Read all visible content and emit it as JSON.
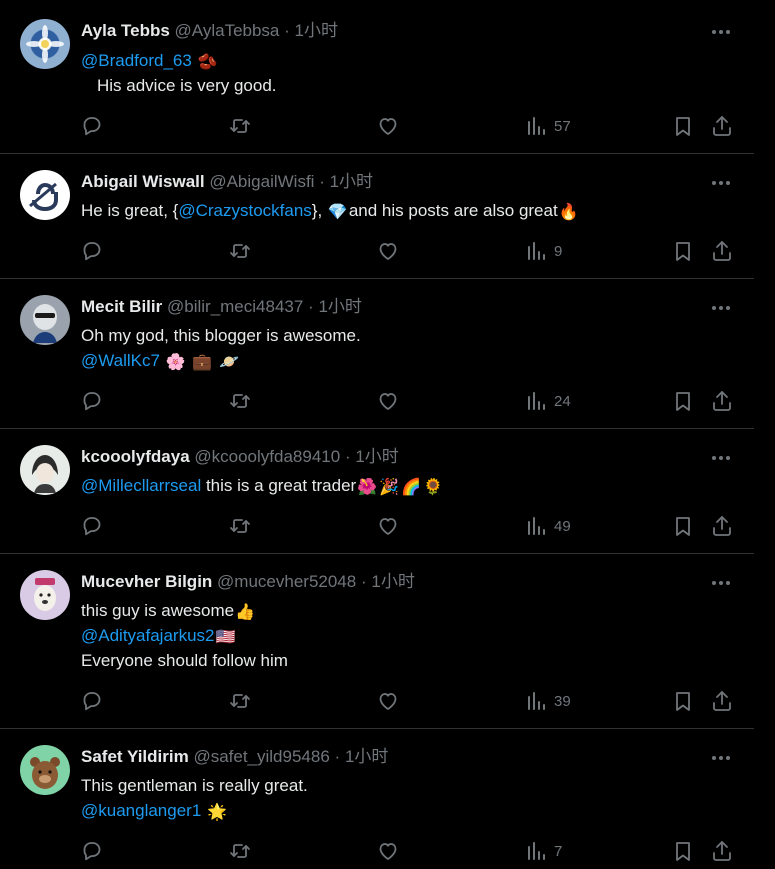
{
  "colors": {
    "background": "#000000",
    "text": "#e7e9ea",
    "muted": "#71767b",
    "link": "#1d9bf0",
    "divider": "#2f3336"
  },
  "icons": {
    "reply": "reply-icon",
    "retweet": "retweet-icon",
    "like": "heart-icon",
    "views": "views-icon",
    "bookmark": "bookmark-icon",
    "share": "share-icon",
    "more": "more-icon"
  },
  "tweets": [
    {
      "name": "Ayla Tebbs",
      "handle": "@AylaTebbsa",
      "sep": "·",
      "time": "1小时",
      "line1_mention": "@Bradford_63",
      "line1_emoji": "🫘",
      "line2_text": "His advice is very good.",
      "views": "57"
    },
    {
      "name": "Abigail Wiswall",
      "handle": "@AbigailWisfi",
      "sep": "·",
      "time": "1小时",
      "text_a": "He is great, {",
      "mention": "@Crazystockfans",
      "text_b": "}, ",
      "emoji_a": "💎",
      "text_c": "and his posts are also great",
      "emoji_b": "🔥",
      "views": "9"
    },
    {
      "name": "Mecit Bilir",
      "handle": "@bilir_meci48437",
      "sep": "·",
      "time": "1小时",
      "line1_text": "Oh my god, this blogger is awesome.",
      "line2_mention": "@WallKc7",
      "emojis": [
        "🌸",
        "💼",
        "🪐"
      ],
      "views": "24"
    },
    {
      "name": "kcooolyfdaya",
      "handle": "@kcooolyfda89410",
      "sep": "·",
      "time": "1小时",
      "mention": "@Millecllarrseal",
      "text": " this is a great trader",
      "emojis": [
        "🌺",
        "🎉",
        "🌈",
        "🌻"
      ],
      "views": "49"
    },
    {
      "name": "Mucevher Bilgin",
      "handle": "@mucevher52048",
      "sep": "·",
      "time": "1小时",
      "line1_text": "this guy is awesome",
      "line1_emoji": "👍",
      "line2_mention": "@Adityafajarkus2",
      "line2_emoji": "🇺🇸",
      "line3_text": "Everyone should follow him",
      "views": "39"
    },
    {
      "name": "Safet Yildirim",
      "handle": "@safet_yild95486",
      "sep": "·",
      "time": "1小时",
      "line1_text": "This gentleman is really great.",
      "line2_mention": "@kuanglanger1",
      "line2_emoji": "🌟",
      "views": "7"
    }
  ]
}
